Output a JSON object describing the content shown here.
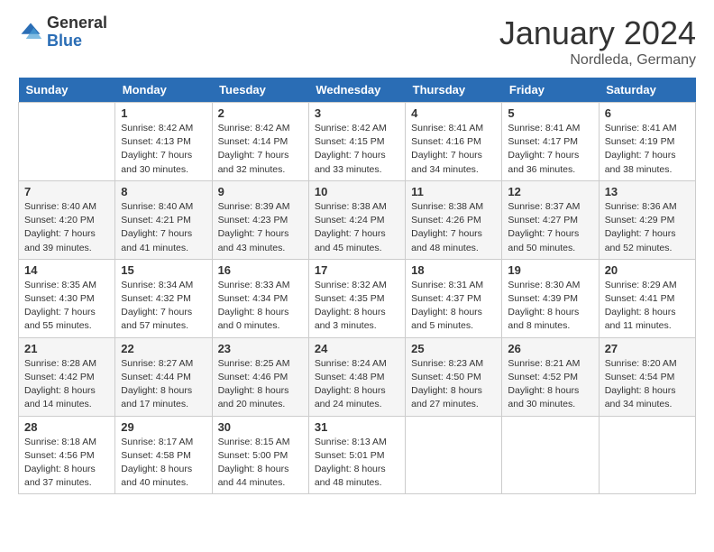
{
  "header": {
    "logo_general": "General",
    "logo_blue": "Blue",
    "month_title": "January 2024",
    "location": "Nordleda, Germany"
  },
  "days_of_week": [
    "Sunday",
    "Monday",
    "Tuesday",
    "Wednesday",
    "Thursday",
    "Friday",
    "Saturday"
  ],
  "weeks": [
    [
      {
        "day": "",
        "sunrise": "",
        "sunset": "",
        "daylight": ""
      },
      {
        "day": "1",
        "sunrise": "Sunrise: 8:42 AM",
        "sunset": "Sunset: 4:13 PM",
        "daylight": "Daylight: 7 hours and 30 minutes."
      },
      {
        "day": "2",
        "sunrise": "Sunrise: 8:42 AM",
        "sunset": "Sunset: 4:14 PM",
        "daylight": "Daylight: 7 hours and 32 minutes."
      },
      {
        "day": "3",
        "sunrise": "Sunrise: 8:42 AM",
        "sunset": "Sunset: 4:15 PM",
        "daylight": "Daylight: 7 hours and 33 minutes."
      },
      {
        "day": "4",
        "sunrise": "Sunrise: 8:41 AM",
        "sunset": "Sunset: 4:16 PM",
        "daylight": "Daylight: 7 hours and 34 minutes."
      },
      {
        "day": "5",
        "sunrise": "Sunrise: 8:41 AM",
        "sunset": "Sunset: 4:17 PM",
        "daylight": "Daylight: 7 hours and 36 minutes."
      },
      {
        "day": "6",
        "sunrise": "Sunrise: 8:41 AM",
        "sunset": "Sunset: 4:19 PM",
        "daylight": "Daylight: 7 hours and 38 minutes."
      }
    ],
    [
      {
        "day": "7",
        "sunrise": "Sunrise: 8:40 AM",
        "sunset": "Sunset: 4:20 PM",
        "daylight": "Daylight: 7 hours and 39 minutes."
      },
      {
        "day": "8",
        "sunrise": "Sunrise: 8:40 AM",
        "sunset": "Sunset: 4:21 PM",
        "daylight": "Daylight: 7 hours and 41 minutes."
      },
      {
        "day": "9",
        "sunrise": "Sunrise: 8:39 AM",
        "sunset": "Sunset: 4:23 PM",
        "daylight": "Daylight: 7 hours and 43 minutes."
      },
      {
        "day": "10",
        "sunrise": "Sunrise: 8:38 AM",
        "sunset": "Sunset: 4:24 PM",
        "daylight": "Daylight: 7 hours and 45 minutes."
      },
      {
        "day": "11",
        "sunrise": "Sunrise: 8:38 AM",
        "sunset": "Sunset: 4:26 PM",
        "daylight": "Daylight: 7 hours and 48 minutes."
      },
      {
        "day": "12",
        "sunrise": "Sunrise: 8:37 AM",
        "sunset": "Sunset: 4:27 PM",
        "daylight": "Daylight: 7 hours and 50 minutes."
      },
      {
        "day": "13",
        "sunrise": "Sunrise: 8:36 AM",
        "sunset": "Sunset: 4:29 PM",
        "daylight": "Daylight: 7 hours and 52 minutes."
      }
    ],
    [
      {
        "day": "14",
        "sunrise": "Sunrise: 8:35 AM",
        "sunset": "Sunset: 4:30 PM",
        "daylight": "Daylight: 7 hours and 55 minutes."
      },
      {
        "day": "15",
        "sunrise": "Sunrise: 8:34 AM",
        "sunset": "Sunset: 4:32 PM",
        "daylight": "Daylight: 7 hours and 57 minutes."
      },
      {
        "day": "16",
        "sunrise": "Sunrise: 8:33 AM",
        "sunset": "Sunset: 4:34 PM",
        "daylight": "Daylight: 8 hours and 0 minutes."
      },
      {
        "day": "17",
        "sunrise": "Sunrise: 8:32 AM",
        "sunset": "Sunset: 4:35 PM",
        "daylight": "Daylight: 8 hours and 3 minutes."
      },
      {
        "day": "18",
        "sunrise": "Sunrise: 8:31 AM",
        "sunset": "Sunset: 4:37 PM",
        "daylight": "Daylight: 8 hours and 5 minutes."
      },
      {
        "day": "19",
        "sunrise": "Sunrise: 8:30 AM",
        "sunset": "Sunset: 4:39 PM",
        "daylight": "Daylight: 8 hours and 8 minutes."
      },
      {
        "day": "20",
        "sunrise": "Sunrise: 8:29 AM",
        "sunset": "Sunset: 4:41 PM",
        "daylight": "Daylight: 8 hours and 11 minutes."
      }
    ],
    [
      {
        "day": "21",
        "sunrise": "Sunrise: 8:28 AM",
        "sunset": "Sunset: 4:42 PM",
        "daylight": "Daylight: 8 hours and 14 minutes."
      },
      {
        "day": "22",
        "sunrise": "Sunrise: 8:27 AM",
        "sunset": "Sunset: 4:44 PM",
        "daylight": "Daylight: 8 hours and 17 minutes."
      },
      {
        "day": "23",
        "sunrise": "Sunrise: 8:25 AM",
        "sunset": "Sunset: 4:46 PM",
        "daylight": "Daylight: 8 hours and 20 minutes."
      },
      {
        "day": "24",
        "sunrise": "Sunrise: 8:24 AM",
        "sunset": "Sunset: 4:48 PM",
        "daylight": "Daylight: 8 hours and 24 minutes."
      },
      {
        "day": "25",
        "sunrise": "Sunrise: 8:23 AM",
        "sunset": "Sunset: 4:50 PM",
        "daylight": "Daylight: 8 hours and 27 minutes."
      },
      {
        "day": "26",
        "sunrise": "Sunrise: 8:21 AM",
        "sunset": "Sunset: 4:52 PM",
        "daylight": "Daylight: 8 hours and 30 minutes."
      },
      {
        "day": "27",
        "sunrise": "Sunrise: 8:20 AM",
        "sunset": "Sunset: 4:54 PM",
        "daylight": "Daylight: 8 hours and 34 minutes."
      }
    ],
    [
      {
        "day": "28",
        "sunrise": "Sunrise: 8:18 AM",
        "sunset": "Sunset: 4:56 PM",
        "daylight": "Daylight: 8 hours and 37 minutes."
      },
      {
        "day": "29",
        "sunrise": "Sunrise: 8:17 AM",
        "sunset": "Sunset: 4:58 PM",
        "daylight": "Daylight: 8 hours and 40 minutes."
      },
      {
        "day": "30",
        "sunrise": "Sunrise: 8:15 AM",
        "sunset": "Sunset: 5:00 PM",
        "daylight": "Daylight: 8 hours and 44 minutes."
      },
      {
        "day": "31",
        "sunrise": "Sunrise: 8:13 AM",
        "sunset": "Sunset: 5:01 PM",
        "daylight": "Daylight: 8 hours and 48 minutes."
      },
      {
        "day": "",
        "sunrise": "",
        "sunset": "",
        "daylight": ""
      },
      {
        "day": "",
        "sunrise": "",
        "sunset": "",
        "daylight": ""
      },
      {
        "day": "",
        "sunrise": "",
        "sunset": "",
        "daylight": ""
      }
    ]
  ]
}
